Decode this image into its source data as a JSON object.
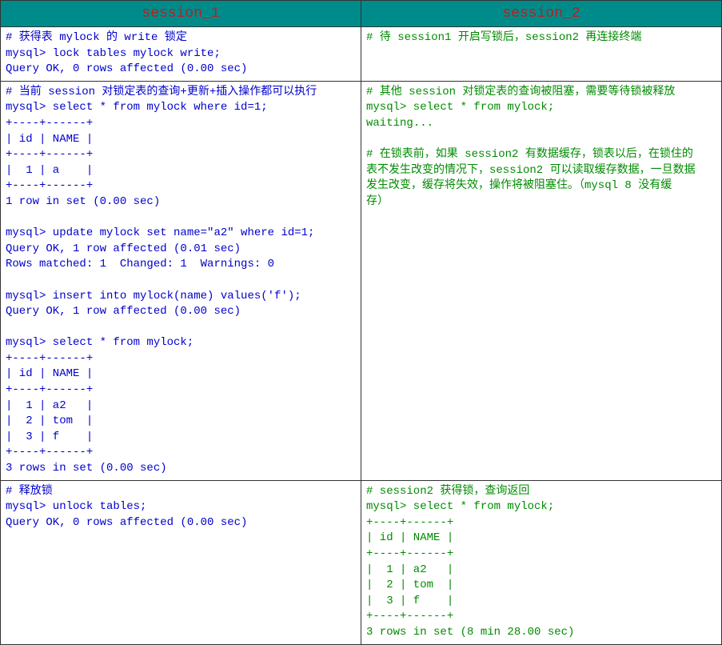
{
  "headers": {
    "left": "session_1",
    "right": "session_2"
  },
  "rows": [
    {
      "left": "# 获得表 mylock 的 write 锁定\nmysql> lock tables mylock write;\nQuery OK, 0 rows affected (0.00 sec)",
      "right": "# 待 session1 开启写锁后，session2 再连接终端"
    },
    {
      "left": "# 当前 session 对锁定表的查询+更新+插入操作都可以执行\nmysql> select * from mylock where id=1;\n+----+------+\n| id | NAME |\n+----+------+\n|  1 | a    |\n+----+------+\n1 row in set (0.00 sec)\n\nmysql> update mylock set name=\"a2\" where id=1;\nQuery OK, 1 row affected (0.01 sec)\nRows matched: 1  Changed: 1  Warnings: 0\n\nmysql> insert into mylock(name) values('f');\nQuery OK, 1 row affected (0.00 sec)\n\nmysql> select * from mylock;\n+----+------+\n| id | NAME |\n+----+------+\n|  1 | a2   |\n|  2 | tom  |\n|  3 | f    |\n+----+------+\n3 rows in set (0.00 sec)",
      "right": "# 其他 session 对锁定表的查询被阻塞，需要等待锁被释放\nmysql> select * from mylock;\nwaiting...\n\n# 在锁表前，如果 session2 有数据缓存，锁表以后，在锁住的\n表不发生改变的情况下，session2 可以读取缓存数据，一旦数据\n发生改变，缓存将失效，操作将被阻塞住。（mysql 8 没有缓\n存）"
    },
    {
      "left": "# 释放锁\nmysql> unlock tables;\nQuery OK, 0 rows affected (0.00 sec)",
      "right": "# session2 获得锁，查询返回\nmysql> select * from mylock;\n+----+------+\n| id | NAME |\n+----+------+\n|  1 | a2   |\n|  2 | tom  |\n|  3 | f    |\n+----+------+\n3 rows in set (8 min 28.00 sec)"
    }
  ]
}
